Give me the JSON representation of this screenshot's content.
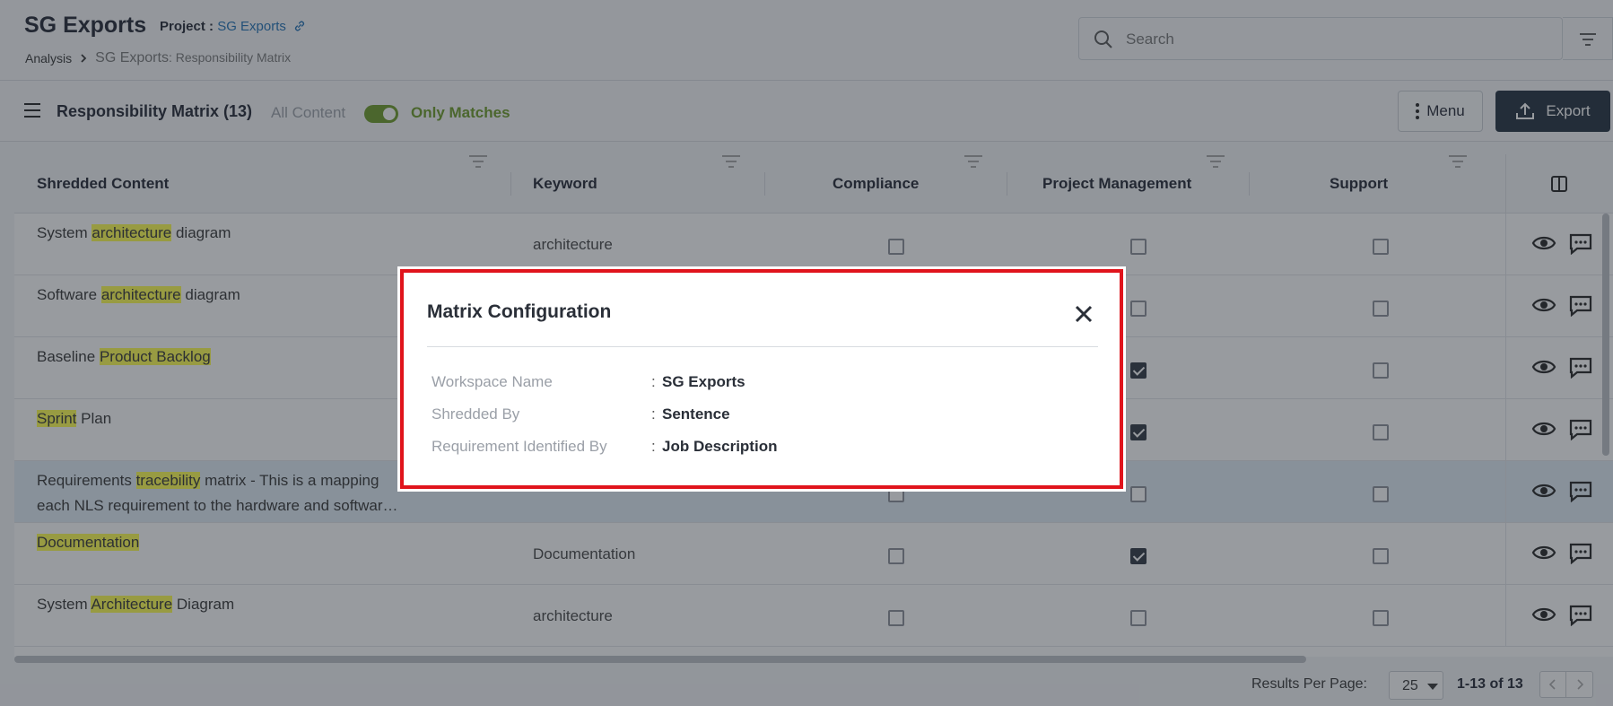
{
  "header": {
    "app_title": "SG Exports",
    "project_label": "Project :",
    "project_name": "SG Exports",
    "breadcrumb": {
      "root": "Analysis",
      "current_main": "SG Exports",
      "current_sub": ": Responsibility Matrix"
    },
    "search_placeholder": "Search"
  },
  "toolbar": {
    "title": "Responsibility Matrix (13)",
    "all_content": "All Content",
    "only_matches": "Only Matches",
    "only_matches_on": true,
    "menu_label": "Menu",
    "export_label": "Export"
  },
  "table": {
    "columns": [
      "Shredded Content",
      "Keyword",
      "Compliance",
      "Project Management",
      "Support"
    ],
    "rows": [
      {
        "pre": "System ",
        "match": "architecture",
        "post": " diagram",
        "line2": "",
        "keyword": "architecture",
        "compliance": false,
        "pm": false,
        "support": false
      },
      {
        "pre": "Software ",
        "match": "architecture",
        "post": " diagram",
        "line2": "",
        "keyword": "",
        "compliance": false,
        "pm": false,
        "support": false
      },
      {
        "pre": "Baseline ",
        "match": "Product Backlog",
        "post": "",
        "line2": "",
        "keyword": "",
        "compliance": false,
        "pm": true,
        "support": false
      },
      {
        "pre": "",
        "match": "Sprint",
        "post": " Plan",
        "line2": "",
        "keyword": "",
        "compliance": false,
        "pm": true,
        "support": false
      },
      {
        "pre": "Requirements ",
        "match": "tracebility",
        "post": " matrix - This is a mapping",
        "line2": "each NLS requirement to the hardware and softwar…",
        "keyword": "",
        "compliance": false,
        "pm": false,
        "support": false
      },
      {
        "pre": "",
        "match": "Documentation",
        "post": "",
        "line2": "",
        "keyword": "Documentation",
        "compliance": false,
        "pm": true,
        "support": false
      },
      {
        "pre": "System ",
        "match": "Architecture",
        "post": " Diagram",
        "line2": "",
        "keyword": "architecture",
        "compliance": false,
        "pm": false,
        "support": false
      }
    ]
  },
  "footer": {
    "results_per_page_label": "Results Per Page:",
    "results_per_page": "25",
    "range": "1-13 of 13"
  },
  "modal": {
    "title": "Matrix Configuration",
    "fields": [
      {
        "label": "Workspace Name",
        "value": "SG Exports"
      },
      {
        "label": "Shredded By",
        "value": "Sentence"
      },
      {
        "label": "Requirement Identified By",
        "value": "Job Description"
      }
    ]
  },
  "icons": {
    "link": "link-icon",
    "search": "search-icon",
    "filter": "filter-icon",
    "hamburger": "hamburger-icon",
    "kebab": "kebab-icon",
    "export": "upload-icon",
    "columns": "columns-icon",
    "eye": "eye-icon",
    "comment": "comment-icon",
    "close": "close-icon",
    "prev": "chevron-left-icon",
    "next": "chevron-right-icon"
  },
  "colors": {
    "accent_green": "#6b9a26",
    "highlight_yellow": "#ffff4d",
    "export_bg": "#1f2d3d",
    "modal_border": "#e0141c",
    "link_blue": "#1f6fb4"
  }
}
